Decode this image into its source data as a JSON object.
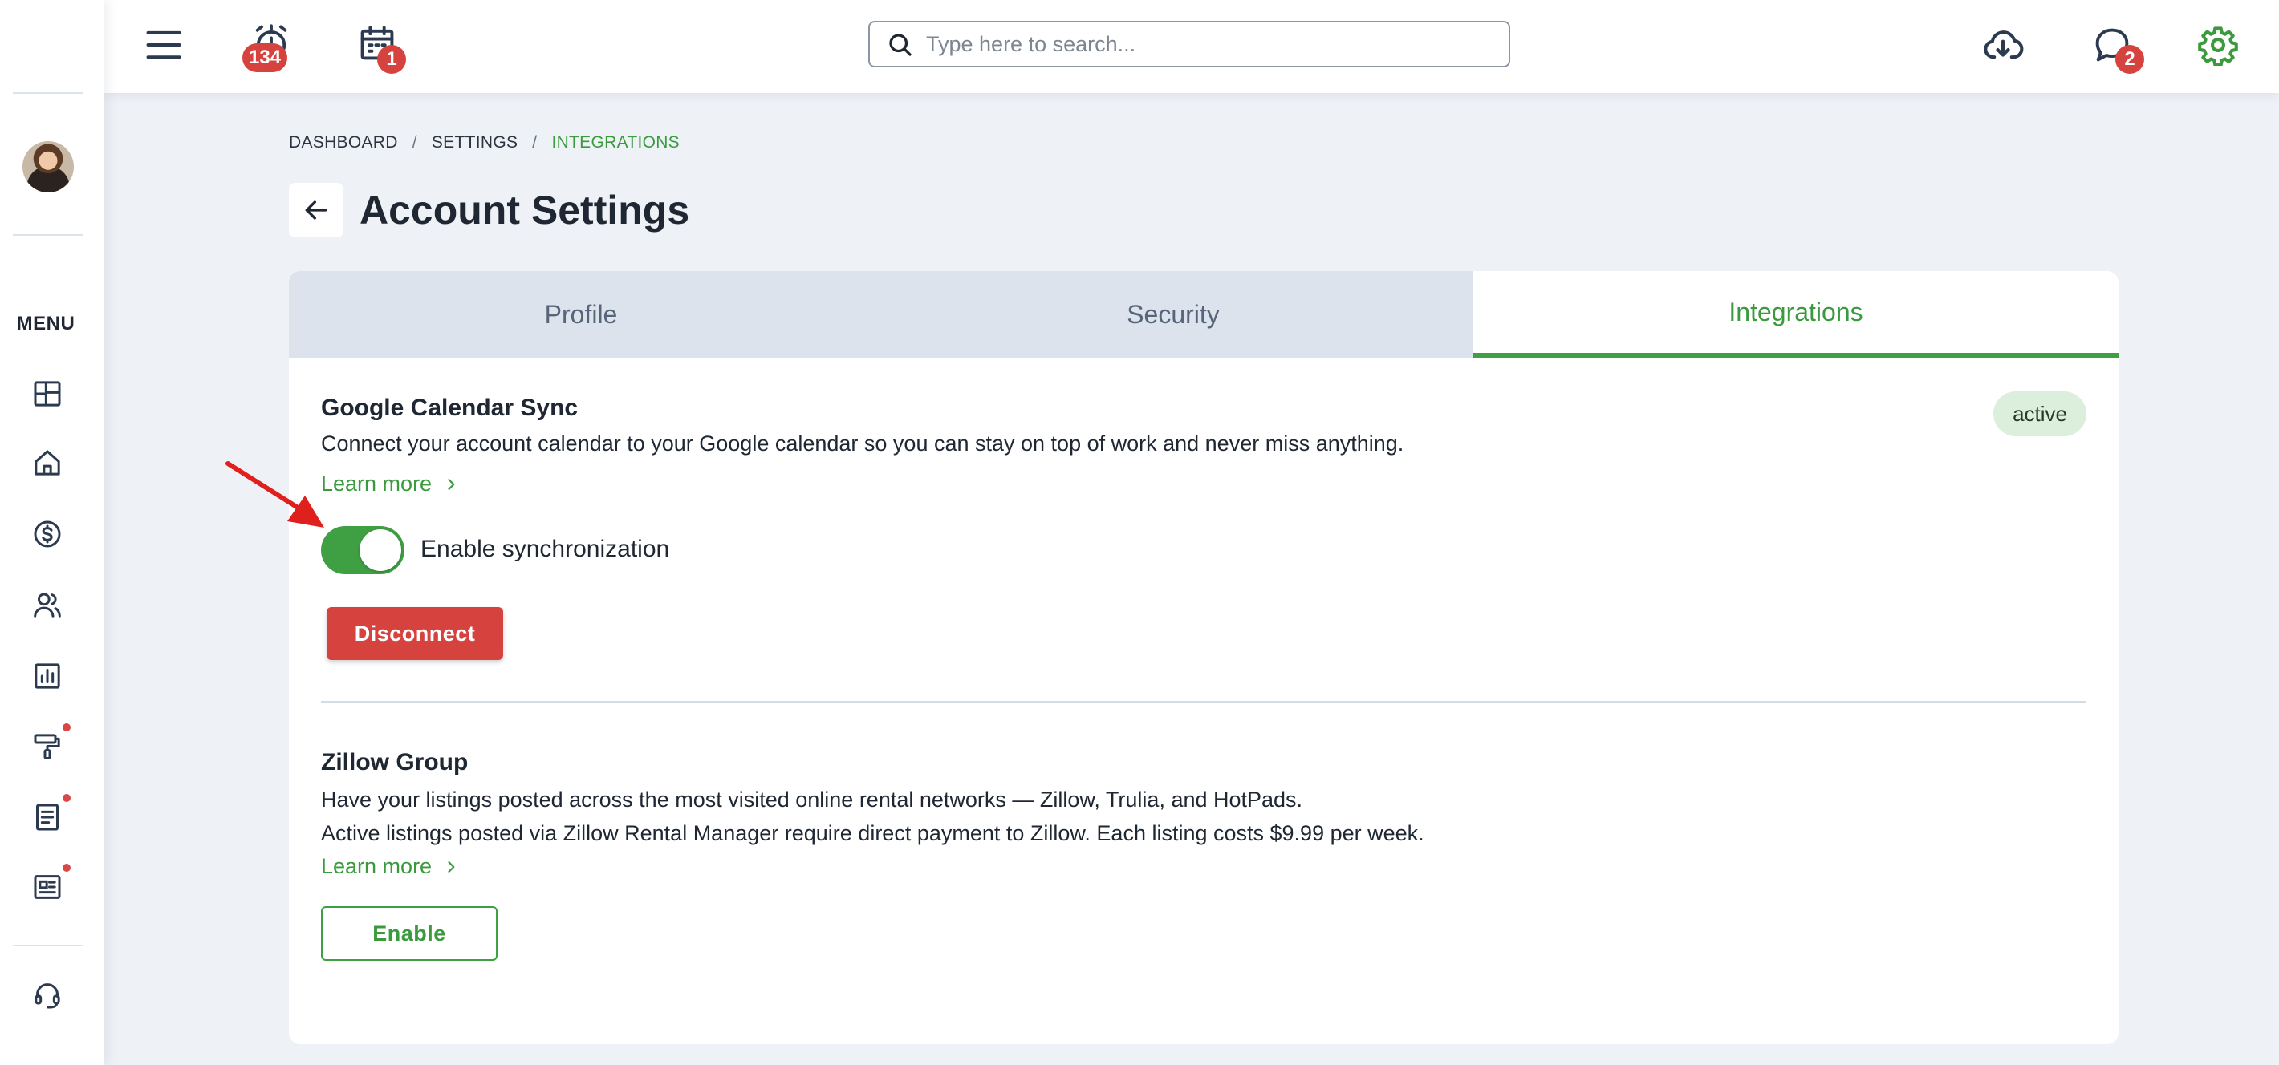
{
  "sidebar": {
    "menu_label": "MENU",
    "items": [
      {
        "icon": "dashboard-grid-icon"
      },
      {
        "icon": "home-icon"
      },
      {
        "icon": "dollar-circle-icon"
      },
      {
        "icon": "users-icon"
      },
      {
        "icon": "reports-chart-icon"
      },
      {
        "icon": "paint-roller-icon",
        "notification_dot": true
      },
      {
        "icon": "document-icon",
        "notification_dot": true
      },
      {
        "icon": "news-icon",
        "notification_dot": true
      }
    ],
    "support_icon": "headset-icon"
  },
  "topbar": {
    "alarm_count": "134",
    "calendar_count": "1",
    "messages_count": "2",
    "search_placeholder": "Type here to search..."
  },
  "breadcrumb": {
    "items": [
      "DASHBOARD",
      "SETTINGS",
      "INTEGRATIONS"
    ],
    "separator": "/"
  },
  "page": {
    "title": "Account Settings"
  },
  "tabs": [
    {
      "label": "Profile",
      "active": false
    },
    {
      "label": "Security",
      "active": false
    },
    {
      "label": "Integrations",
      "active": true
    }
  ],
  "integrations": {
    "google": {
      "title": "Google Calendar Sync",
      "description": "Connect your account calendar to your Google calendar so you can stay on top of work and never miss anything.",
      "learn_more": "Learn more",
      "status": "active",
      "toggle_label": "Enable synchronization",
      "toggle_on": true,
      "button": "Disconnect"
    },
    "zillow": {
      "title": "Zillow Group",
      "description_1": "Have your listings posted across the most visited online rental networks — Zillow, Trulia, and HotPads.",
      "description_2": "Active listings posted via Zillow Rental Manager require direct payment to Zillow. Each listing costs $9.99 per week.",
      "learn_more": "Learn more",
      "button": "Enable"
    }
  },
  "colors": {
    "accent_green": "#3f9f43",
    "danger_red": "#d6433f",
    "badge_red": "#d6433f",
    "page_bg": "#eef2f7",
    "tab_bg": "#dce3ec"
  }
}
